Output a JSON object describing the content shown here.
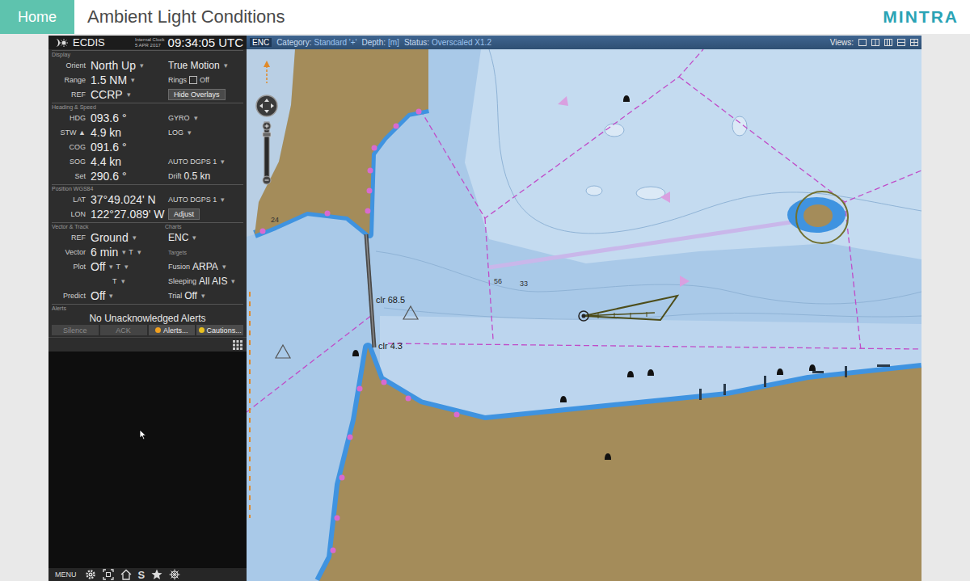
{
  "header": {
    "home": "Home",
    "title": "Ambient Light Conditions",
    "logo": "MINTRA"
  },
  "ecdis": {
    "title": "ECDIS",
    "clock_label": "Internal Clock",
    "date": "5 APR 2017",
    "time": "09:34:05 UTC",
    "sections": [
      {
        "title": "Display",
        "rows": [
          {
            "left": [
              {
                "kind": "label",
                "text": "Orient"
              },
              {
                "kind": "value",
                "text": "North Up"
              },
              {
                "kind": "caret",
                "text": "▾"
              }
            ],
            "right": [
              {
                "kind": "value",
                "text": "True Motion"
              },
              {
                "kind": "caret",
                "text": "▾"
              }
            ]
          },
          {
            "left": [
              {
                "kind": "label",
                "text": "Range"
              },
              {
                "kind": "value",
                "text": "1.5 NM"
              },
              {
                "kind": "caret",
                "text": "▾"
              }
            ],
            "right": [
              {
                "kind": "small",
                "text": "Rings"
              },
              {
                "kind": "check",
                "checked": false
              },
              {
                "kind": "small",
                "text": "Off"
              }
            ]
          },
          {
            "left": [
              {
                "kind": "label",
                "text": "REF"
              },
              {
                "kind": "value",
                "text": "CCRP"
              },
              {
                "kind": "caret",
                "text": "▾"
              }
            ],
            "right": [
              {
                "kind": "button",
                "text": "Hide Overlays"
              }
            ]
          }
        ]
      },
      {
        "title": "Heading & Speed",
        "rows": [
          {
            "left": [
              {
                "kind": "label",
                "text": "HDG"
              },
              {
                "kind": "value",
                "text": "093.6 °"
              }
            ],
            "right": [
              {
                "kind": "small",
                "text": "GYRO"
              },
              {
                "kind": "caret",
                "text": "▾"
              }
            ]
          },
          {
            "left": [
              {
                "kind": "label",
                "text": "STW ▲"
              },
              {
                "kind": "value",
                "text": "4.9 kn"
              }
            ],
            "right": [
              {
                "kind": "small",
                "text": "LOG"
              },
              {
                "kind": "caret",
                "text": "▾"
              }
            ]
          },
          {
            "left": [
              {
                "kind": "label",
                "text": "COG"
              },
              {
                "kind": "value",
                "text": "091.6 °"
              }
            ],
            "right": []
          },
          {
            "left": [
              {
                "kind": "label",
                "text": "SOG"
              },
              {
                "kind": "value",
                "text": "4.4 kn"
              }
            ],
            "right": [
              {
                "kind": "small",
                "text": "AUTO DGPS 1"
              },
              {
                "kind": "caret",
                "text": "▾"
              }
            ]
          },
          {
            "left": [
              {
                "kind": "label",
                "text": "Set"
              },
              {
                "kind": "value",
                "text": "290.6 °"
              }
            ],
            "right": [
              {
                "kind": "small",
                "text": "Drift"
              },
              {
                "kind": "value",
                "text": "0.5 kn"
              }
            ]
          }
        ]
      },
      {
        "title": "Position WGS84",
        "rows": [
          {
            "left": [
              {
                "kind": "label",
                "text": "LAT"
              },
              {
                "kind": "value",
                "text": "37°49.024' N"
              }
            ],
            "right": [
              {
                "kind": "small",
                "text": "AUTO DGPS 1"
              },
              {
                "kind": "caret",
                "text": "▾"
              }
            ]
          },
          {
            "left": [
              {
                "kind": "label",
                "text": "LON"
              },
              {
                "kind": "value",
                "text": "122°27.089' W"
              }
            ],
            "right": [
              {
                "kind": "button",
                "text": "Adjust"
              }
            ]
          }
        ]
      },
      {
        "title": "Vector & Track",
        "title_right": "Charts",
        "rows": [
          {
            "left": [
              {
                "kind": "label",
                "text": "REF"
              },
              {
                "kind": "value",
                "text": "Ground"
              },
              {
                "kind": "caret",
                "text": "▾"
              }
            ],
            "right": [
              {
                "kind": "value",
                "text": "ENC"
              },
              {
                "kind": "caret",
                "text": "▾"
              }
            ]
          },
          {
            "left": [
              {
                "kind": "label",
                "text": "Vector"
              },
              {
                "kind": "value",
                "text": "6 min"
              },
              {
                "kind": "caret",
                "text": "▾"
              },
              {
                "kind": "small",
                "text": "T"
              },
              {
                "kind": "caret",
                "text": "▾"
              }
            ],
            "right": [
              {
                "kind": "header",
                "text": "Targets"
              }
            ]
          },
          {
            "left": [
              {
                "kind": "label",
                "text": "Plot"
              },
              {
                "kind": "value",
                "text": "Off"
              },
              {
                "kind": "caret",
                "text": "▾"
              },
              {
                "kind": "small",
                "text": "T"
              },
              {
                "kind": "caret",
                "text": "▾"
              }
            ],
            "right": [
              {
                "kind": "small",
                "text": "Fusion"
              },
              {
                "kind": "value",
                "text": "ARPA"
              },
              {
                "kind": "caret",
                "text": "▾"
              }
            ]
          },
          {
            "left": [
              {
                "kind": "spacer"
              },
              {
                "kind": "blank"
              },
              {
                "kind": "small",
                "text": "T"
              },
              {
                "kind": "caret",
                "text": "▾"
              }
            ],
            "right": [
              {
                "kind": "small",
                "text": "Sleeping"
              },
              {
                "kind": "value",
                "text": "All AIS"
              },
              {
                "kind": "caret",
                "text": "▾"
              }
            ]
          },
          {
            "left": [
              {
                "kind": "label",
                "text": "Predict"
              },
              {
                "kind": "value",
                "text": "Off"
              },
              {
                "kind": "caret",
                "text": "▾"
              }
            ],
            "right": [
              {
                "kind": "small",
                "text": "Trial"
              },
              {
                "kind": "value",
                "text": "Off"
              },
              {
                "kind": "caret",
                "text": "▾"
              }
            ]
          }
        ]
      }
    ],
    "alerts": {
      "title": "Alerts",
      "message": "No Unacknowledged Alerts",
      "buttons": [
        {
          "label": "Silence",
          "disabled": true
        },
        {
          "label": "ACK",
          "disabled": true
        },
        {
          "label": "Alerts...",
          "disabled": false,
          "color": "#f0a020"
        },
        {
          "label": "Cautions...",
          "disabled": false,
          "color": "#e8c020"
        }
      ]
    },
    "toolbar": {
      "menu": "MENU",
      "letter": "S"
    }
  },
  "chart": {
    "source": "ENC",
    "fields": [
      {
        "label": "Category:",
        "value": "Standard '+'"
      },
      {
        "label": "Depth:",
        "value": "[m]"
      },
      {
        "label": "Status:",
        "value": "Overscaled X1.2"
      }
    ],
    "views_label": "Views:",
    "labels": [
      "clr 68.5",
      "clr 4.3"
    ],
    "soundings": [
      "24",
      "56",
      "33"
    ]
  }
}
